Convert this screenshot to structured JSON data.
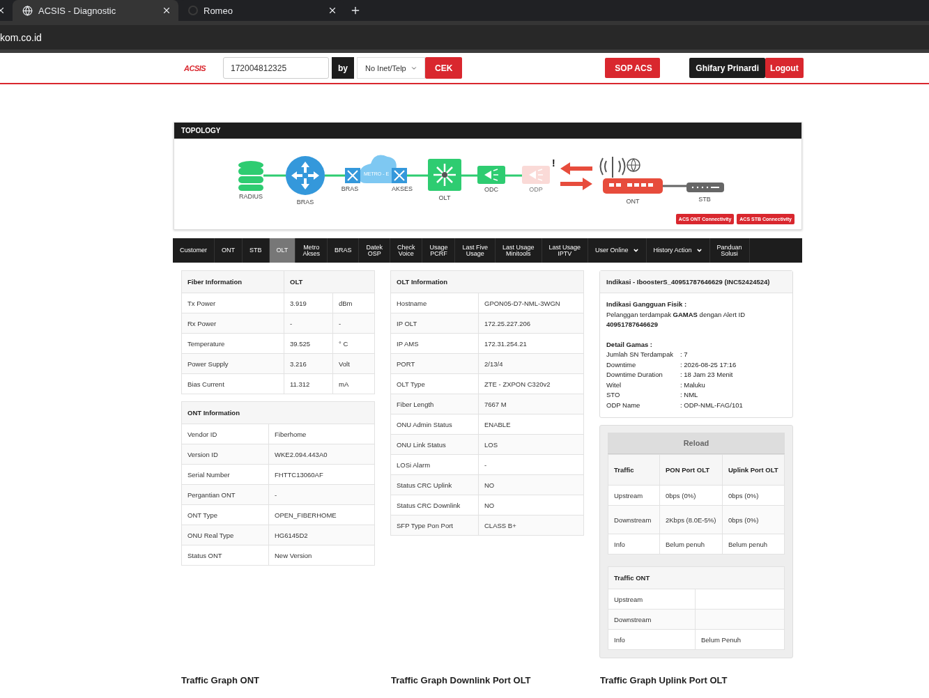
{
  "browser": {
    "tabs": [
      {
        "title": "ACSIS - Diagnostic",
        "selected": true,
        "kind": "globe"
      },
      {
        "title": "Romeo",
        "selected": false,
        "kind": "loading"
      }
    ],
    "address": "kom.co.id"
  },
  "header": {
    "logo": "ACSIS",
    "search_value": "172004812325",
    "by_label": "by",
    "search_type": "No Inet/Telp",
    "check_button": "CEK",
    "sop_button": "SOP ACS",
    "user": "Ghifary Prinardi",
    "logout_button": "Logout"
  },
  "topology": {
    "title": "TOPOLOGY",
    "nodes": [
      {
        "kind": "database",
        "label": "RADIUS",
        "fault": false
      },
      {
        "kind": "router",
        "label": "BRAS",
        "fault": false
      },
      {
        "kind": "metro",
        "label": "METRO - E",
        "left_label": "BRAS",
        "right_label": "AKSES",
        "fault": false
      },
      {
        "kind": "olt",
        "label": "OLT",
        "fault": false
      },
      {
        "kind": "splitter",
        "label": "ODC",
        "fault": false
      },
      {
        "kind": "odp",
        "label": "ODP",
        "fault": true
      },
      {
        "kind": "ont",
        "label": "ONT",
        "fault": false
      },
      {
        "kind": "stb",
        "label": "STB",
        "fault": false
      }
    ],
    "alert_mark": "!",
    "buttons": [
      "ACS ONT Connectivity",
      "ACS STB Connectivity"
    ]
  },
  "nav_tabs": [
    {
      "label": "Customer",
      "selected": false,
      "dropdown": false
    },
    {
      "label": "ONT",
      "selected": false,
      "dropdown": false
    },
    {
      "label": "STB",
      "selected": false,
      "dropdown": false
    },
    {
      "label": "OLT",
      "selected": true,
      "dropdown": false
    },
    {
      "label": "Metro\nAkses",
      "selected": false,
      "dropdown": false
    },
    {
      "label": "BRAS",
      "selected": false,
      "dropdown": false
    },
    {
      "label": "Datek\nOSP",
      "selected": false,
      "dropdown": false
    },
    {
      "label": "Check\nVoice",
      "selected": false,
      "dropdown": false
    },
    {
      "label": "Usage\nPCRF",
      "selected": false,
      "dropdown": false
    },
    {
      "label": "Last Five\nUsage",
      "selected": false,
      "dropdown": false
    },
    {
      "label": "Last Usage\nMinitools",
      "selected": false,
      "dropdown": false
    },
    {
      "label": "Last Usage\nIPTV",
      "selected": false,
      "dropdown": false
    },
    {
      "label": "User Online",
      "selected": false,
      "dropdown": true
    },
    {
      "label": "History Action",
      "selected": false,
      "dropdown": true
    },
    {
      "label": "Panduan\nSolusi",
      "selected": false,
      "dropdown": false
    }
  ],
  "fiber_information": {
    "columns": [
      "Fiber Information",
      "OLT"
    ],
    "rows": [
      [
        "Tx Power",
        "3.919",
        "dBm"
      ],
      [
        "Rx Power",
        "-",
        "-"
      ],
      [
        "Temperature",
        "39.525",
        "° C"
      ],
      [
        "Power Supply",
        "3.216",
        "Volt"
      ],
      [
        "Bias Current",
        "11.312",
        "mA"
      ]
    ]
  },
  "ont_information": {
    "title": "ONT Information",
    "rows": [
      [
        "Vendor ID",
        "Fiberhome"
      ],
      [
        "Version ID",
        "WKE2.094.443A0"
      ],
      [
        "Serial Number",
        "FHTTC13060AF"
      ],
      [
        "Pergantian ONT",
        "-"
      ],
      [
        "ONT Type",
        "OPEN_FIBERHOME"
      ],
      [
        "ONU Real Type",
        "HG6145D2"
      ],
      [
        "Status ONT",
        "New Version"
      ]
    ]
  },
  "olt_information": {
    "title": "OLT Information",
    "rows": [
      [
        "Hostname",
        "GPON05-D7-NML-3WGN"
      ],
      [
        "IP OLT",
        "172.25.227.206"
      ],
      [
        "IP AMS",
        "172.31.254.21"
      ],
      [
        "PORT",
        "2/13/4"
      ],
      [
        "OLT Type",
        "ZTE - ZXPON C320v2"
      ],
      [
        "Fiber Length",
        "7667 M"
      ],
      [
        "ONU Admin Status",
        "ENABLE"
      ],
      [
        "ONU Link Status",
        "LOS"
      ],
      [
        "LOSi Alarm",
        "-"
      ],
      [
        "Status CRC Uplink",
        "NO"
      ],
      [
        "Status CRC Downlink",
        "NO"
      ],
      [
        "SFP Type Pon Port",
        "CLASS B+"
      ]
    ]
  },
  "indikasi": {
    "title": "Indikasi - IboosterS_40951787646629 (INC52424524)",
    "heading": "Indikasi Gangguan Fisik :",
    "message": "Pelanggan terdampak **GAMAS** dengan Alert ID **40951787646629**",
    "detail_heading": "Detail Gamas :",
    "details": [
      {
        "label": "Jumlah SN Terdampak",
        "value": ": 7"
      },
      {
        "label": "Downtime",
        "value": ": 2026-08-25 17:16"
      },
      {
        "label": "Downtime Duration",
        "value": ": 18 Jam 23 Menit"
      },
      {
        "label": "Witel",
        "value": ": Maluku"
      },
      {
        "label": "STO",
        "value": ": NML"
      },
      {
        "label": "ODP Name",
        "value": ": ODP-NML-FAG/101"
      }
    ]
  },
  "traffic": {
    "reload_button": "Reload",
    "columns": [
      "Traffic",
      "PON Port OLT",
      "Uplink Port OLT"
    ],
    "rows": [
      [
        "Upstream",
        "0bps (0%)",
        "0bps (0%)"
      ],
      [
        "Downstream",
        "2Kbps (8.0E-5%)",
        "0bps (0%)"
      ],
      [
        "Info",
        "Belum penuh",
        "Belum penuh"
      ]
    ],
    "ont_title": "Traffic ONT",
    "ont_rows": [
      {
        "label": "Upstream"
      },
      {
        "label": "Downstream"
      },
      {
        "label": "Info",
        "value": "Belum Penuh"
      }
    ]
  },
  "graph_titles": [
    "Traffic Graph ONT",
    "Traffic Graph Downlink Port OLT",
    "Traffic Graph Uplink Port OLT"
  ]
}
